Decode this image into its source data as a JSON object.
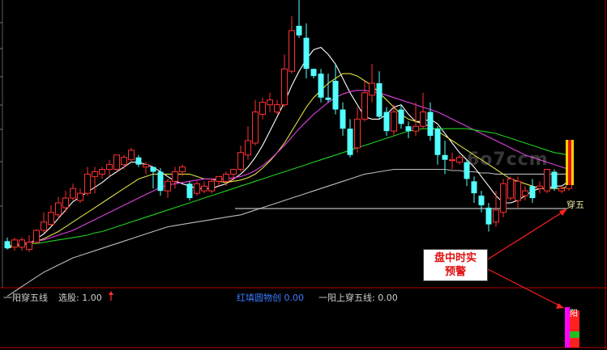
{
  "indicator": {
    "name": "一阳穿五线",
    "xuangu_label": "选股: 1.00",
    "mid_label": "红填圆物创 0.00",
    "yang_label": "一阳上穿五线: 0.00"
  },
  "alert": {
    "line1": "盘中时实",
    "line2": "预警"
  },
  "signal_top": "穿五",
  "signal_bottom": "阳",
  "watermark": "6o7ccm",
  "colors": {
    "background": "#000000",
    "bull": "#ff3030",
    "bear": "#54ffff",
    "ma5": "#ffffff",
    "ma10": "#e0e040",
    "ma20": "#e040e0",
    "ma30": "#20d020",
    "ma60": "#bdbdbd",
    "frame": "#b00000",
    "alert_text": "#e01010"
  },
  "chart_data": {
    "type": "candlestick",
    "candles": [
      [
        16,
        10,
        9,
        19
      ],
      [
        11,
        17,
        8,
        19
      ],
      [
        11,
        17,
        8,
        19
      ],
      [
        9,
        15,
        7,
        21
      ],
      [
        15,
        25,
        14,
        26
      ],
      [
        25,
        32,
        23,
        40
      ],
      [
        30,
        40,
        28,
        46
      ],
      [
        38,
        48,
        34,
        53
      ],
      [
        44,
        52,
        40,
        58
      ],
      [
        52,
        60,
        50,
        64
      ],
      [
        50,
        56,
        48,
        60
      ],
      [
        56,
        72,
        54,
        78
      ],
      [
        70,
        74,
        56,
        78
      ],
      [
        72,
        76,
        68,
        78
      ],
      [
        76,
        80,
        70,
        84
      ],
      [
        76,
        88,
        74,
        88
      ],
      [
        80,
        86,
        76,
        88
      ],
      [
        84,
        92,
        82,
        94
      ],
      [
        86,
        80,
        78,
        88
      ],
      [
        78,
        80,
        72,
        82
      ],
      [
        78,
        74,
        60,
        78
      ],
      [
        74,
        58,
        54,
        77
      ],
      [
        58,
        66,
        52,
        68
      ],
      [
        66,
        74,
        60,
        78
      ],
      [
        74,
        78,
        70,
        80
      ],
      [
        64,
        52,
        50,
        66
      ],
      [
        56,
        64,
        54,
        66
      ],
      [
        58,
        62,
        56,
        66
      ],
      [
        58,
        66,
        56,
        68
      ],
      [
        66,
        70,
        62,
        70
      ],
      [
        66,
        72,
        62,
        74
      ],
      [
        72,
        76,
        66,
        76
      ],
      [
        76,
        90,
        74,
        96
      ],
      [
        88,
        100,
        84,
        112
      ],
      [
        98,
        124,
        96,
        134
      ],
      [
        122,
        132,
        118,
        136
      ],
      [
        130,
        134,
        124,
        140
      ],
      [
        124,
        130,
        122,
        134
      ],
      [
        130,
        160,
        128,
        172
      ],
      [
        158,
        192,
        156,
        204
      ],
      [
        196,
        188,
        186,
        220
      ],
      [
        186,
        160,
        152,
        198
      ],
      [
        160,
        154,
        152,
        160
      ],
      [
        156,
        136,
        132,
        160
      ],
      [
        136,
        134,
        132,
        156
      ],
      [
        150,
        126,
        122,
        164
      ],
      [
        126,
        110,
        104,
        132
      ],
      [
        110,
        88,
        86,
        118
      ],
      [
        94,
        118,
        90,
        128
      ],
      [
        118,
        140,
        116,
        150
      ],
      [
        138,
        148,
        132,
        164
      ],
      [
        148,
        120,
        118,
        158
      ],
      [
        124,
        108,
        104,
        128
      ],
      [
        108,
        124,
        104,
        130
      ],
      [
        126,
        114,
        110,
        130
      ],
      [
        112,
        108,
        102,
        116
      ],
      [
        108,
        112,
        104,
        132
      ],
      [
        112,
        124,
        110,
        140
      ],
      [
        124,
        104,
        100,
        132
      ],
      [
        110,
        88,
        80,
        112
      ],
      [
        88,
        84,
        72,
        100
      ],
      [
        84,
        84,
        76,
        90
      ],
      [
        82,
        86,
        80,
        88
      ],
      [
        82,
        68,
        62,
        84
      ],
      [
        66,
        56,
        48,
        70
      ],
      [
        54,
        46,
        40,
        58
      ],
      [
        44,
        30,
        24,
        48
      ],
      [
        32,
        42,
        28,
        58
      ],
      [
        40,
        64,
        36,
        68
      ],
      [
        52,
        68,
        50,
        70
      ],
      [
        50,
        66,
        44,
        70
      ],
      [
        54,
        58,
        50,
        62
      ],
      [
        62,
        52,
        48,
        68
      ],
      [
        60,
        62,
        56,
        66
      ],
      [
        58,
        76,
        56,
        76
      ],
      [
        74,
        60,
        58,
        76
      ],
      [
        58,
        60,
        56,
        62
      ],
      [
        60,
        92,
        58,
        92
      ]
    ],
    "ma_lines": [
      {
        "name": "MA5",
        "values": [
          10,
          12,
          13,
          14,
          18,
          22,
          28,
          35,
          42,
          49,
          53,
          57,
          61,
          65,
          70,
          74,
          78,
          82,
          82,
          80,
          78,
          74,
          70,
          66,
          64,
          62,
          60,
          60,
          60,
          62,
          64,
          68,
          72,
          78,
          86,
          96,
          108,
          120,
          132,
          146,
          158,
          168,
          176,
          178,
          172,
          164,
          152,
          140,
          130,
          120,
          118,
          118,
          122,
          128,
          130,
          122,
          116,
          116,
          118,
          114,
          106,
          98,
          90,
          84,
          78,
          70,
          62,
          54,
          48,
          48,
          50,
          54,
          58,
          60,
          60,
          62,
          62,
          66
        ]
      },
      {
        "name": "MA10",
        "values": [
          11,
          12,
          13,
          14,
          16,
          18,
          21,
          24,
          28,
          32,
          36,
          40,
          44,
          48,
          52,
          56,
          60,
          64,
          68,
          70,
          72,
          72,
          72,
          72,
          72,
          72,
          70,
          68,
          68,
          66,
          65,
          66,
          67,
          69,
          72,
          77,
          83,
          90,
          98,
          108,
          118,
          128,
          136,
          142,
          148,
          152,
          156,
          156,
          154,
          150,
          146,
          140,
          134,
          128,
          122,
          118,
          116,
          114,
          112,
          108,
          104,
          100,
          96,
          92,
          88,
          84,
          80,
          76,
          72,
          68,
          66,
          64,
          62,
          60,
          60,
          60,
          60,
          62
        ]
      },
      {
        "name": "MA20",
        "values": [
          12,
          13,
          14,
          15,
          16,
          17,
          19,
          21,
          23,
          25,
          28,
          31,
          34,
          37,
          40,
          43,
          46,
          49,
          52,
          55,
          58,
          61,
          63,
          64,
          65,
          66,
          67,
          68,
          68,
          68,
          68,
          69,
          70,
          72,
          75,
          79,
          84,
          90,
          96,
          103,
          110,
          116,
          122,
          127,
          132,
          136,
          139,
          141,
          142,
          142,
          141,
          140,
          138,
          136,
          134,
          132,
          130,
          128,
          126,
          124,
          121,
          118,
          115,
          112,
          109,
          106,
          103,
          100,
          97,
          94,
          91,
          88,
          86,
          84,
          82,
          80,
          78,
          76
        ]
      },
      {
        "name": "MA30",
        "values": [
          12,
          13,
          13,
          14,
          14,
          15,
          16,
          17,
          18,
          19,
          20,
          21,
          23,
          24,
          26,
          28,
          30,
          32,
          34,
          36,
          38,
          40,
          42,
          44,
          46,
          48,
          50,
          52,
          54,
          56,
          58,
          60,
          62,
          64,
          66,
          68,
          70,
          72,
          74,
          76,
          78,
          80,
          82,
          84,
          86,
          88,
          90,
          92,
          94,
          96,
          98,
          100,
          102,
          104,
          106,
          108,
          109,
          110,
          110,
          110,
          110,
          110,
          110,
          110,
          109,
          108,
          107,
          106,
          104,
          102,
          100,
          98,
          96,
          94,
          92,
          90,
          89,
          88
        ]
      },
      {
        "name": "MA60",
        "values": [
          -30,
          -26,
          -22,
          -18,
          -14,
          -10,
          -7,
          -4,
          -1,
          2,
          4,
          6,
          8,
          10,
          12,
          14,
          16,
          18,
          20,
          22,
          24,
          26,
          28,
          29,
          30,
          31,
          32,
          33,
          34,
          35,
          36,
          37,
          38,
          40,
          42,
          44,
          46,
          48,
          50,
          52,
          54,
          56,
          58,
          60,
          62,
          64,
          66,
          68,
          70,
          72,
          73,
          74,
          75,
          76,
          76,
          76,
          76,
          76,
          76,
          76,
          76,
          75,
          75,
          74,
          74,
          73,
          73,
          72,
          72,
          72,
          72,
          72,
          72,
          72,
          72,
          72,
          72,
          72
        ]
      }
    ],
    "xlabel": "",
    "ylabel": "",
    "grid": false
  }
}
